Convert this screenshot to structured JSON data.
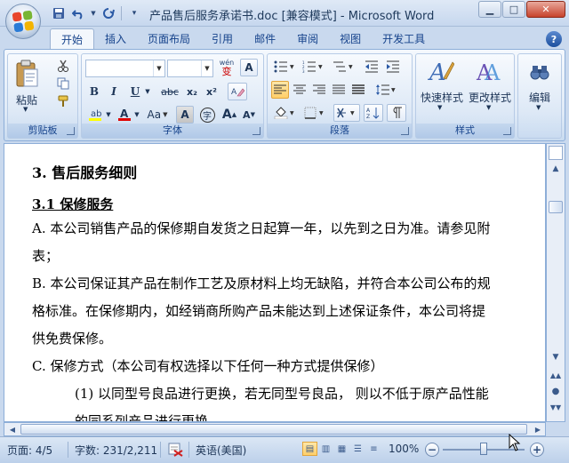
{
  "window": {
    "title": "产品售后服务承诺书.doc [兼容模式] - Microsoft Word",
    "minimize": "▁",
    "maximize": "□",
    "close": "✕"
  },
  "qat": {
    "save_icon": "save-icon",
    "undo_icon": "undo-icon",
    "redo_icon": "redo-icon",
    "customize_icon": "customize-icon"
  },
  "tabs": [
    {
      "label": "开始",
      "active": true
    },
    {
      "label": "插入"
    },
    {
      "label": "页面布局"
    },
    {
      "label": "引用"
    },
    {
      "label": "邮件"
    },
    {
      "label": "审阅"
    },
    {
      "label": "视图"
    },
    {
      "label": "开发工具"
    }
  ],
  "ribbon": {
    "clipboard": {
      "label": "剪贴板",
      "paste": "粘贴"
    },
    "font": {
      "label": "字体",
      "font_name": "",
      "font_size": "",
      "wen": "wén",
      "wen_char": "变",
      "bold": "B",
      "italic": "I",
      "underline": "U",
      "strike": "abc",
      "sub": "x₂",
      "sup": "x²",
      "aa": "Aa",
      "grow": "A",
      "shrink": "A",
      "char_a": "A",
      "circle_char": "字"
    },
    "paragraph": {
      "label": "段落"
    },
    "styles": {
      "label": "样式",
      "quick": "快速样式",
      "change": "更改样式"
    },
    "editing": {
      "label": "编辑"
    }
  },
  "document": {
    "heading3": "3. 售后服务细则",
    "heading31": "3.1 保修服务",
    "lines": [
      "A. 本公司销售产品的保修期自发货之日起算一年，以先到之日为准。请参见附",
      "表；",
      "B. 本公司保证其产品在制作工艺及原材料上均无缺陷，并符合本公司公布的规",
      "格标准。在保修期内，如经销商所购产品未能达到上述保证条件，本公司将提",
      "供免费保修。",
      "C. 保修方式（本公司有权选择以下任何一种方式提供保修）",
      "(1) 以同型号良品进行更换，若无同型号良品， 则以不低于原产品性能",
      "的同系列产品进行更换。"
    ]
  },
  "statusbar": {
    "page": "页面: 4/5",
    "words": "字数: 231/2,211",
    "language": "英语(美国)",
    "zoom": "100%",
    "zoom_level": 1.0
  },
  "colors": {
    "accent": "#15428b",
    "highlight": "#ffcf6a",
    "font_color_red": "#e00000",
    "highlight_yellow": "#ffff00"
  }
}
